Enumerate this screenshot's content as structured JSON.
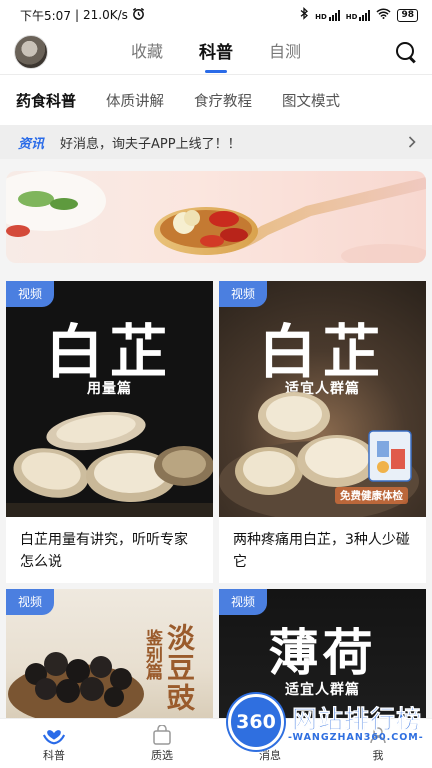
{
  "status_bar": {
    "time": "下午5:07",
    "speed": "21.0K/s",
    "network": "HD",
    "battery": "98"
  },
  "top_nav": {
    "tabs": [
      {
        "label": "收藏"
      },
      {
        "label": "科普"
      },
      {
        "label": "自测"
      }
    ],
    "active_tab": "科普"
  },
  "sub_tabs": [
    {
      "label": "药食科普"
    },
    {
      "label": "体质讲解"
    },
    {
      "label": "食疗教程"
    },
    {
      "label": "图文模式"
    }
  ],
  "news": {
    "tag": "资讯",
    "text": "好消息，询夫子APP上线了！！"
  },
  "cards": [
    {
      "badge": "视频",
      "title": "白芷",
      "subtitle": "用量篇",
      "caption": "白芷用量有讲究，听听专家怎么说"
    },
    {
      "badge": "视频",
      "title": "白芷",
      "subtitle": "适宜人群篇",
      "caption": "两种疼痛用白芷，3种人少碰它",
      "overlay": "免费健康体检"
    },
    {
      "badge": "视频",
      "title": "淡豆豉",
      "subtitle": "鉴别篇"
    },
    {
      "badge": "视频",
      "title": "薄荷",
      "subtitle": "适宜人群篇"
    }
  ],
  "bottom_nav": [
    {
      "label": "科普",
      "icon": "heart-hands-icon"
    },
    {
      "label": "质选",
      "icon": "bag-icon"
    },
    {
      "label": "消息",
      "icon": "message-icon"
    },
    {
      "label": "我",
      "icon": "user-icon"
    }
  ],
  "watermark": {
    "badge": "360",
    "text": "网站排行榜",
    "url": "-WANGZHAN360.COM-"
  },
  "colors": {
    "accent": "#2a6be8",
    "badge": "#4b7fe0"
  }
}
